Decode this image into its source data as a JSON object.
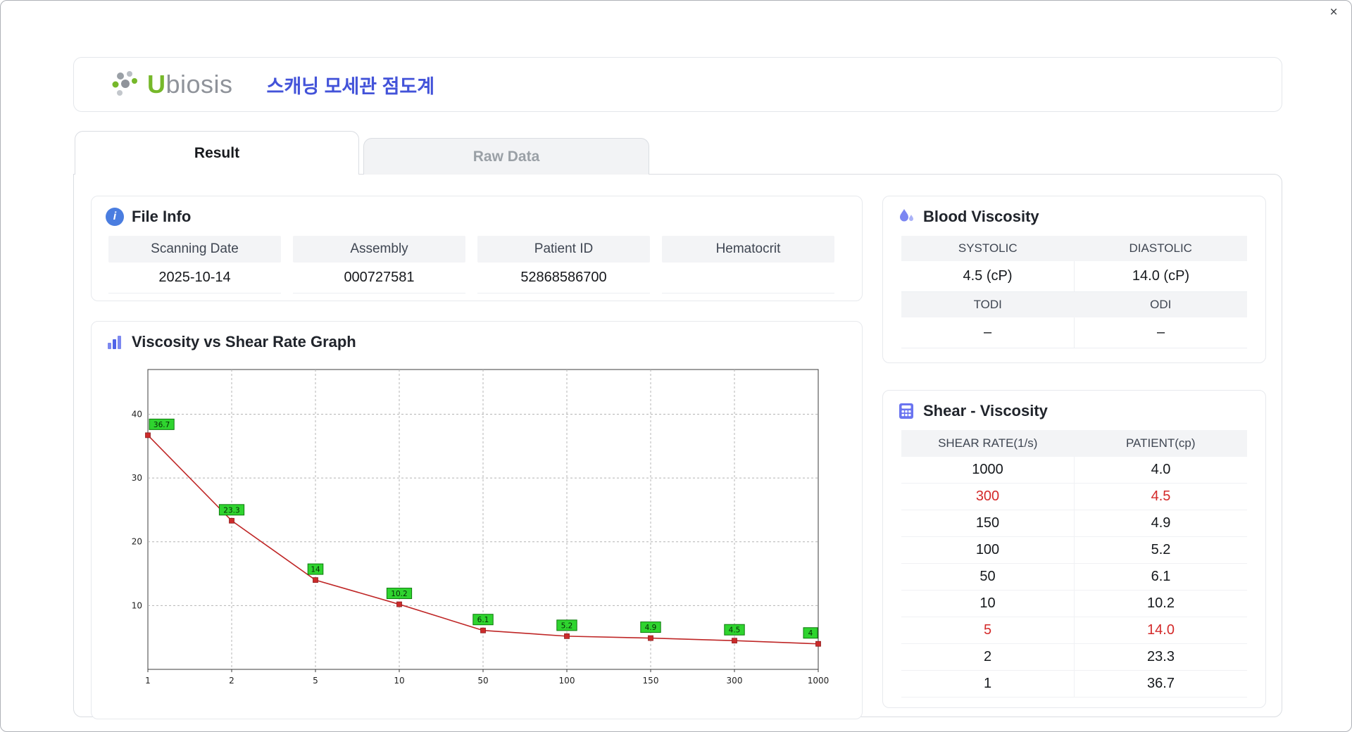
{
  "window": {
    "close_glyph": "×"
  },
  "icons": {
    "info_glyph": "i"
  },
  "colors": {
    "accent_blue": "#4353d9",
    "highlight_red": "#d42a2a",
    "brand_green": "#76b82a"
  },
  "header": {
    "logo_u": "U",
    "logo_rest": "biosis",
    "title": "스캐닝 모세관 점도계"
  },
  "tabs": [
    {
      "label": "Result",
      "active": true
    },
    {
      "label": "Raw Data",
      "active": false
    }
  ],
  "file_info": {
    "title": "File Info",
    "fields": [
      {
        "label": "Scanning Date",
        "value": "2025-10-14"
      },
      {
        "label": "Assembly",
        "value": "000727581"
      },
      {
        "label": "Patient ID",
        "value": "52868586700"
      },
      {
        "label": "Hematocrit",
        "value": ""
      }
    ]
  },
  "graph": {
    "title": "Viscosity vs Shear Rate Graph"
  },
  "chart_data": {
    "type": "line",
    "title": "Viscosity vs Shear Rate Graph",
    "xlabel": "",
    "ylabel": "",
    "x_scale": "category",
    "grid": true,
    "legend": false,
    "x_categories": [
      "1",
      "2",
      "5",
      "10",
      "50",
      "100",
      "150",
      "300",
      "1000"
    ],
    "values": [
      36.7,
      23.3,
      14,
      10.2,
      6.1,
      5.2,
      4.9,
      4.5,
      4
    ],
    "point_labels": [
      "36.7",
      "23.3",
      "14",
      "10.2",
      "6.1",
      "5.2",
      "4.9",
      "4.5",
      "4"
    ],
    "y_ticks": [
      10,
      20,
      30,
      40
    ],
    "ylim": [
      0,
      47
    ],
    "line_color": "#bf2626",
    "marker_color": "#cc2b2b",
    "label_bg": "#2fd42f",
    "label_border": "#0c7a0c"
  },
  "blood_viscosity": {
    "title": "Blood Viscosity",
    "cells": [
      {
        "label": "SYSTOLIC",
        "value": "4.5 (cP)"
      },
      {
        "label": "DIASTOLIC",
        "value": "14.0 (cP)"
      },
      {
        "label": "TODI",
        "value": "–"
      },
      {
        "label": "ODI",
        "value": "–"
      }
    ]
  },
  "shear_viscosity": {
    "title": "Shear - Viscosity",
    "columns": [
      "SHEAR RATE(1/s)",
      "PATIENT(cp)"
    ],
    "rows": [
      {
        "shear": "1000",
        "patient": "4.0",
        "highlight": false
      },
      {
        "shear": "300",
        "patient": "4.5",
        "highlight": true
      },
      {
        "shear": "150",
        "patient": "4.9",
        "highlight": false
      },
      {
        "shear": "100",
        "patient": "5.2",
        "highlight": false
      },
      {
        "shear": "50",
        "patient": "6.1",
        "highlight": false
      },
      {
        "shear": "10",
        "patient": "10.2",
        "highlight": false
      },
      {
        "shear": "5",
        "patient": "14.0",
        "highlight": true
      },
      {
        "shear": "2",
        "patient": "23.3",
        "highlight": false
      },
      {
        "shear": "1",
        "patient": "36.7",
        "highlight": false
      }
    ]
  }
}
